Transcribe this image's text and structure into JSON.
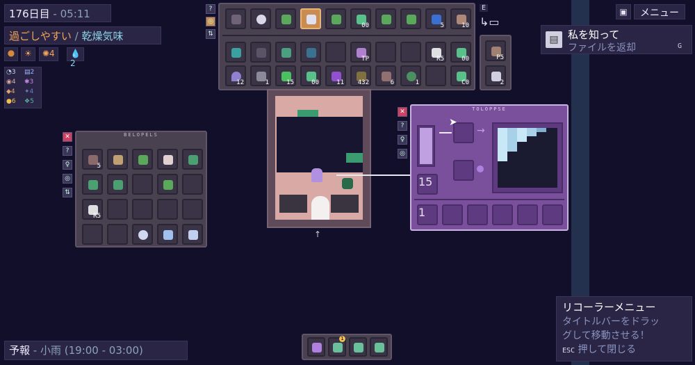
{
  "hud": {
    "day": "176日目",
    "sep_time": "-",
    "time": "05:11",
    "weather_condition": "過ごしやすい",
    "weather_sep": "/",
    "weather_type": "乾燥気味",
    "stats": [
      "☀",
      "✺4",
      "💧2"
    ],
    "resources": [
      {
        "v": "3"
      },
      {
        "v": "2"
      },
      {
        "v": "4"
      },
      {
        "v": "3"
      },
      {
        "v": "4"
      },
      {
        "v": "4"
      },
      {
        "v": "6"
      },
      {
        "v": "5"
      }
    ]
  },
  "forecast": {
    "label": "予報",
    "sep": "-",
    "value": "小雨 (19:00 - 03:00)"
  },
  "menu": {
    "key_e": "E",
    "button": "メニュー"
  },
  "quest": {
    "title": "私を知って",
    "subtitle": "ファイルを返却",
    "key": "G"
  },
  "recorder": {
    "title": "リコーラーメニュー",
    "line1": "タイトルバーをドラッ",
    "line2": "グして移動させる！",
    "esc_key": "ESC",
    "esc_text": "押して閉じる"
  },
  "toolbar": {
    "counts": [
      "",
      "",
      "",
      "",
      "",
      "00",
      "",
      "",
      "5",
      "10"
    ]
  },
  "inventory": {
    "row2_counts": [
      "",
      "",
      "",
      "",
      "",
      "TP",
      "",
      "",
      "R5",
      "00"
    ],
    "row3_counts": [
      "12",
      "1",
      "15",
      "00",
      "11",
      "432",
      "6",
      "1",
      "",
      "C0"
    ]
  },
  "side_items": {
    "top": "P5",
    "bottom": "2"
  },
  "left_panel": {
    "title": "BELOPELS",
    "counts": [
      "5",
      "",
      "",
      "",
      "",
      "",
      "",
      "",
      "",
      "",
      "R5",
      "",
      "",
      "",
      "",
      "",
      "",
      "",
      "",
      ""
    ]
  },
  "craft_panel": {
    "title": "TOLOPPSE",
    "input_count": "15",
    "bottom_count": "1"
  },
  "hotbar": {
    "badge": "1"
  },
  "colors": {
    "bg": "#120f2b",
    "accent_orange": "#f2a65a",
    "accent_cyan": "#8cd3e6",
    "panel_purple": "#7a4f9c"
  }
}
